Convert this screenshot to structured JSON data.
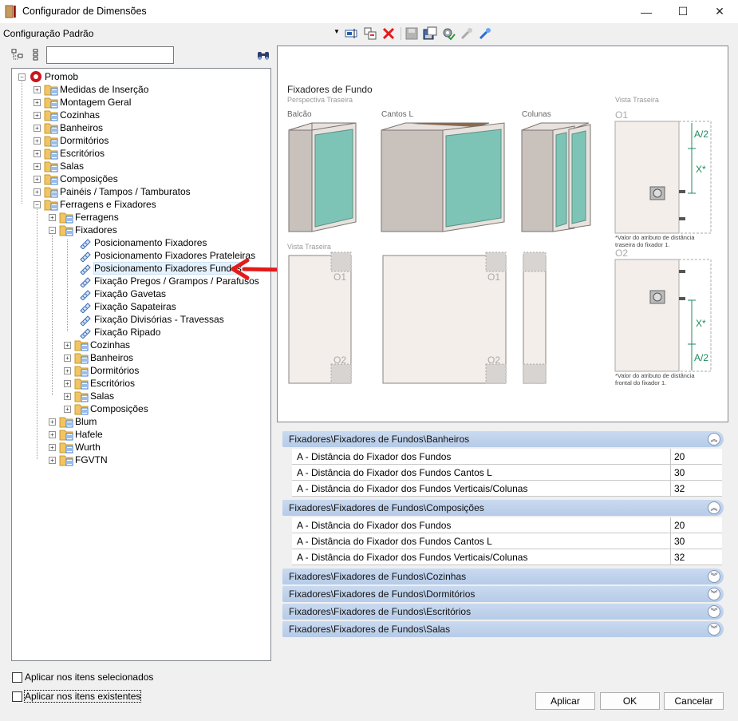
{
  "window": {
    "title": "Configurador de Dimensões",
    "minimize_glyph": "—",
    "maximize_glyph": "☐",
    "close_glyph": "✕"
  },
  "toolbar": {
    "config_label": "Configuração Padrão",
    "icons": [
      "edit-field-icon",
      "copy-icon",
      "delete-icon",
      "save-icon",
      "save-as-icon",
      "settings-gear-icon",
      "import-icon",
      "export-icon"
    ],
    "search_placeholder": "",
    "search_icon": "binoculars-icon"
  },
  "tree": {
    "root": "Promob",
    "level1": [
      "Medidas de Inserção",
      "Montagem Geral",
      "Cozinhas",
      "Banheiros",
      "Dormitórios",
      "Escritórios",
      "Salas",
      "Composições",
      "Painéis / Tampos / Tamburatos",
      "Ferragens e Fixadores"
    ],
    "level2": [
      "Ferragens",
      "Fixadores"
    ],
    "fixadores_items": [
      "Posicionamento Fixadores",
      "Posicionamento Fixadores Prateleiras",
      "Posicionamento Fixadores Fundos",
      "Fixação Pregos / Grampos / Parafusos",
      "Fixação Gavetas",
      "Fixação Sapateiras",
      "Fixação Divisórias - Travessas",
      "Fixação Ripado"
    ],
    "fixadores_folders": [
      "Cozinhas",
      "Banheiros",
      "Dormitórios",
      "Escritórios",
      "Salas",
      "Composições"
    ],
    "level1_tail": [
      "Blum",
      "Hafele",
      "Wurth",
      "FGVTN"
    ],
    "selected": "Posicionamento Fixadores Fundos"
  },
  "diagram": {
    "title": "Fixadores de Fundo",
    "subtitle": "Perspectiva Traseira",
    "labels": {
      "balcao": "Balcão",
      "cantos": "Cantos L",
      "colunas": "Colunas",
      "vista_traseira": "Vista Traseira",
      "vista_traseira2": "Vista Traseira"
    },
    "o1": "O1",
    "o2": "O2",
    "a2": "A/2",
    "x": "X*",
    "note1": [
      "*Valor do atributo de distância",
      "traseira do fixador 1."
    ],
    "note2": [
      "*Valor do atributo de distância",
      "frontal do fixador 1."
    ]
  },
  "groups": [
    {
      "title": "Fixadores\\Fixadores de Fundos\\Banheiros",
      "expanded": true,
      "rows": [
        {
          "k": "A - Distância do Fixador dos Fundos",
          "v": "20"
        },
        {
          "k": "A - Distância do Fixador dos Fundos Cantos L",
          "v": "30"
        },
        {
          "k": "A - Distância do Fixador dos Fundos Verticais/Colunas",
          "v": "32"
        }
      ]
    },
    {
      "title": "Fixadores\\Fixadores de Fundos\\Composições",
      "expanded": true,
      "rows": [
        {
          "k": "A - Distância do Fixador dos Fundos",
          "v": "20"
        },
        {
          "k": "A - Distância do Fixador dos Fundos Cantos L",
          "v": "30"
        },
        {
          "k": "A - Distância do Fixador dos Fundos Verticais/Colunas",
          "v": "32"
        }
      ]
    },
    {
      "title": "Fixadores\\Fixadores de Fundos\\Cozinhas",
      "expanded": false
    },
    {
      "title": "Fixadores\\Fixadores de Fundos\\Dormitórios",
      "expanded": false
    },
    {
      "title": "Fixadores\\Fixadores de Fundos\\Escritórios",
      "expanded": false
    },
    {
      "title": "Fixadores\\Fixadores de Fundos\\Salas",
      "expanded": false
    }
  ],
  "footer": {
    "chk1": "Aplicar nos itens selecionados",
    "chk2": "Aplicar nos itens existentes",
    "apply": "Aplicar",
    "ok": "OK",
    "cancel": "Cancelar"
  },
  "colors": {
    "accent_arrow": "#e21b1b",
    "teal_panel": "#7ec4b6",
    "group_header": "#c2d5ee",
    "dimension_green": "#1d8b5c"
  }
}
